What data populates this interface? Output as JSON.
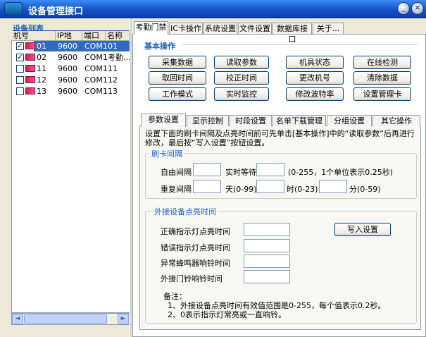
{
  "window": {
    "title": "设备管理接口",
    "minimize": "_",
    "close": "×"
  },
  "device_list": {
    "label": "设备列表",
    "columns": [
      "机号",
      "IP地址...",
      "端口",
      "名称"
    ],
    "rows": [
      {
        "checked": true,
        "id": "01",
        "ip": "9600",
        "port": "COM1",
        "name": "01",
        "selected": true
      },
      {
        "checked": true,
        "id": "02",
        "ip": "9600",
        "port": "COM1",
        "name": "考勤..."
      },
      {
        "checked": false,
        "id": "11",
        "ip": "9600",
        "port": "COM1",
        "name": "11"
      },
      {
        "checked": false,
        "id": "12",
        "ip": "9600",
        "port": "COM1",
        "name": "12"
      },
      {
        "checked": false,
        "id": "13",
        "ip": "9600",
        "port": "COM1",
        "name": "13"
      }
    ],
    "scroll_left": "◄",
    "scroll_right": "►"
  },
  "main_tabs": [
    "考勤门禁",
    "IC卡操作",
    "系统设置",
    "文件设置",
    "数据库接口",
    "关于..."
  ],
  "basic_ops": {
    "title": "基本操作",
    "buttons": [
      "采集数据",
      "读取参数",
      "机具状态",
      "在线检测",
      "取回时间",
      "校正时间",
      "更改机号",
      "清除数据",
      "工作模式",
      "实时监控",
      "修改波特率",
      "设置管理卡"
    ]
  },
  "sub_tabs": [
    "参数设置",
    "显示控制",
    "时段设置",
    "名单下载管理",
    "分组设置",
    "其它操作"
  ],
  "params": {
    "instruction": "设置下面的刷卡间隔及点亮时间前可先单击[基本操作]中的“读取参数”后再进行修改，最后按“写入设置”按钮设置。",
    "card_interval": {
      "title": "刷卡间隔",
      "free_interval": "自由间隔",
      "realtime_wait": "实时等待",
      "realtime_hint": "(0-255，1个单位表示0.25秒)",
      "repeat_interval": "重复间隔",
      "day": "天(0-99)",
      "hour": "时(0-23)",
      "minute": "分(0-59)"
    },
    "external": {
      "title": "外接设备点亮时间",
      "correct_light": "正确指示灯点亮时间",
      "error_light": "错误指示灯点亮时间",
      "buzzer": "异常蜂鸣器响铃时间",
      "door_bell": "外接门铃响铃时间",
      "write_button": "写入设置",
      "note_title": "备注：",
      "note1": "1、外接设备点亮时间有效值范围是0-255，每个值表示0.2秒。",
      "note2": "2、0表示指示灯常亮或一直响铃。"
    }
  }
}
